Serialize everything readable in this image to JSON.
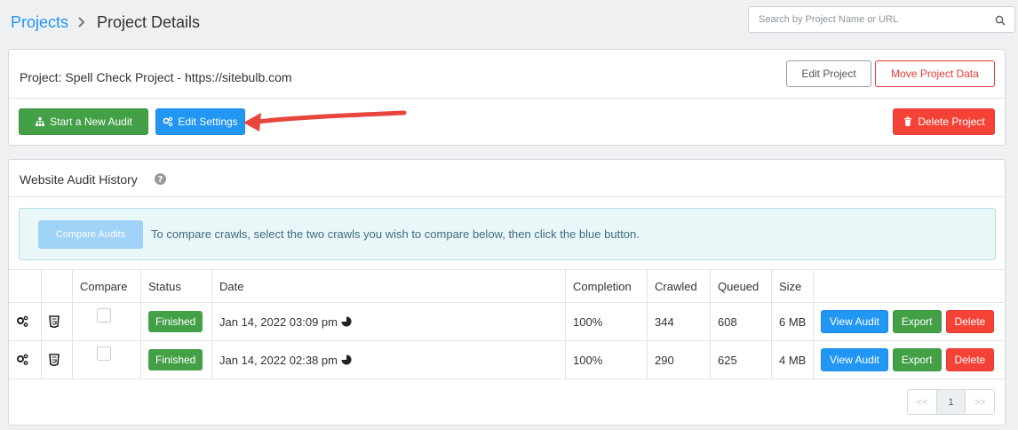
{
  "breadcrumb": {
    "link": "Projects",
    "current": "Project Details"
  },
  "search": {
    "placeholder": "Search by Project Name or URL"
  },
  "project": {
    "title": "Project: Spell Check Project - https://sitebulb.com",
    "edit_project": "Edit Project",
    "move_project": "Move Project Data",
    "start_audit": "Start a New Audit",
    "edit_settings": "Edit Settings",
    "delete_project": "Delete Project"
  },
  "history": {
    "title": "Website Audit History",
    "compare_button": "Compare Audits",
    "info_text": "To compare crawls, select the two crawls you wish to compare below, then click the blue button.",
    "columns": [
      "Compare",
      "Status",
      "Date",
      "Completion",
      "Crawled",
      "Queued",
      "Size"
    ],
    "rows": [
      {
        "status": "Finished",
        "date": "Jan 14, 2022 03:09 pm",
        "completion": "100%",
        "crawled": "344",
        "queued": "608",
        "size": "6 MB"
      },
      {
        "status": "Finished",
        "date": "Jan 14, 2022 02:38 pm",
        "completion": "100%",
        "crawled": "290",
        "queued": "625",
        "size": "4 MB"
      }
    ],
    "actions": {
      "view": "View Audit",
      "export": "Export",
      "delete": "Delete"
    },
    "pager": {
      "prev": "<<",
      "page": "1",
      "next": ">>"
    }
  },
  "colors": {
    "blue": "#2196f3",
    "green": "#43a047",
    "red": "#f44336",
    "arrow": "#e8453c"
  }
}
